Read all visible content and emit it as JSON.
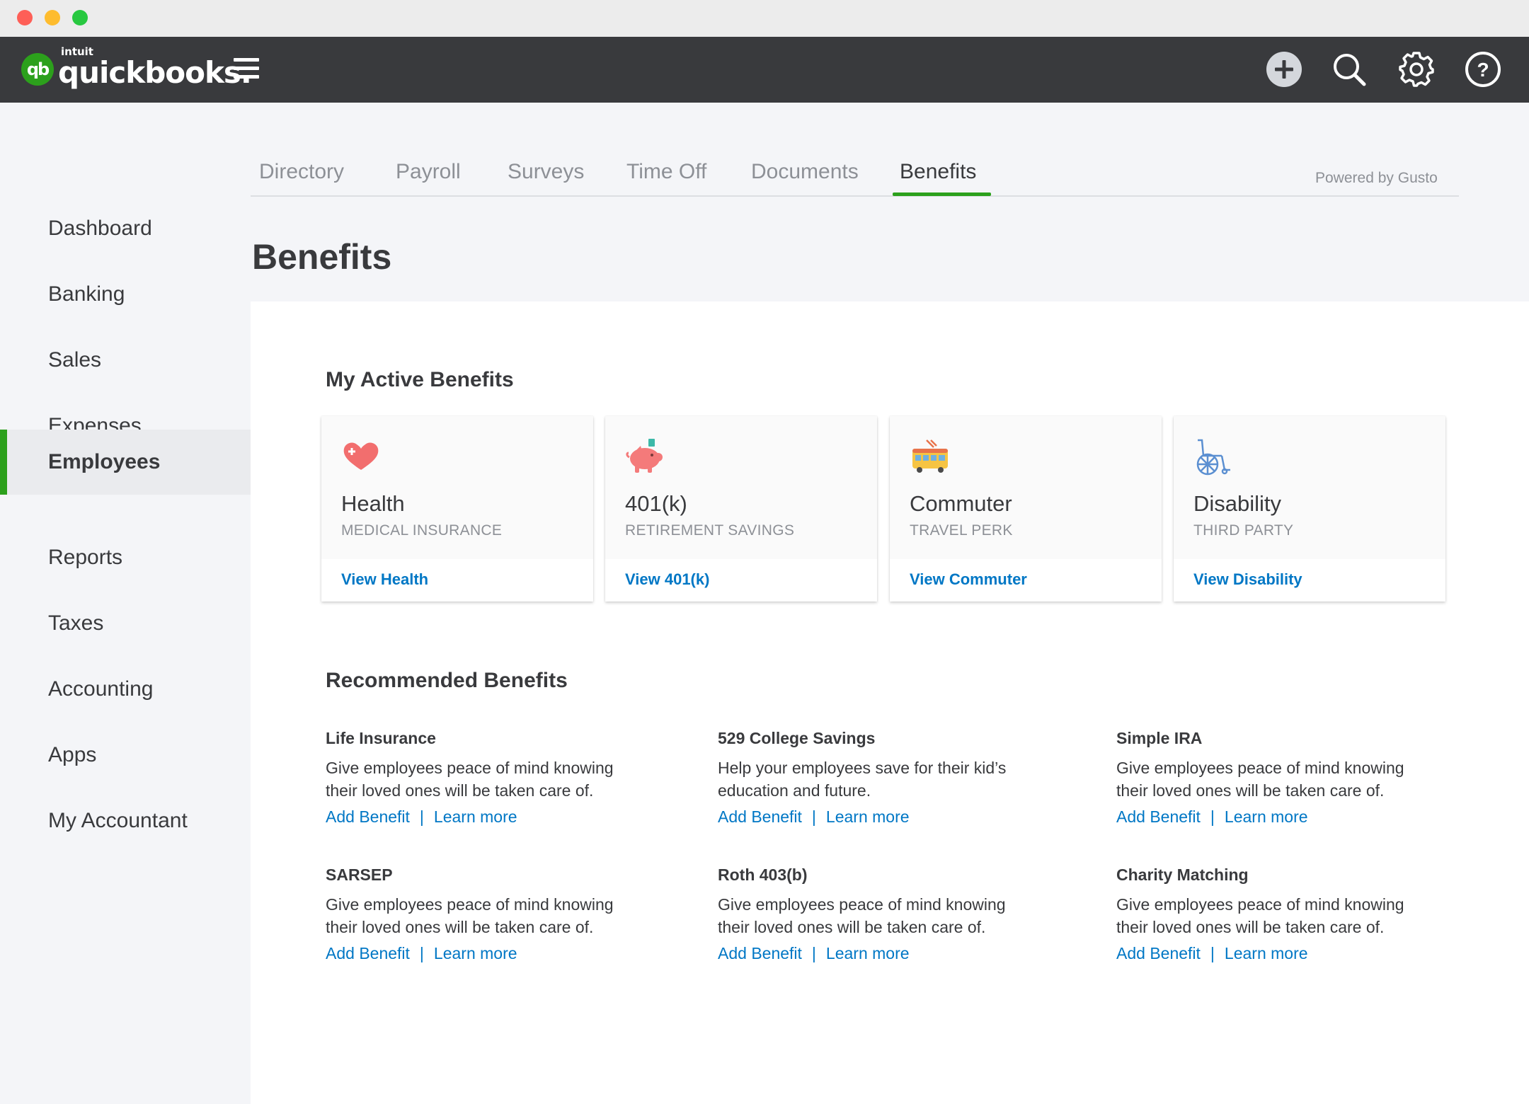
{
  "app": {
    "brand_small": "intuit",
    "brand_name": "quickbooks.",
    "logo_mark": "qb"
  },
  "topnav_icons": [
    "plus-icon",
    "search-icon",
    "gear-icon",
    "help-icon"
  ],
  "sidebar": {
    "items": [
      {
        "label": "Dashboard"
      },
      {
        "label": "Banking"
      },
      {
        "label": "Sales"
      },
      {
        "label": "Expenses"
      },
      {
        "label": "Employees",
        "active": true
      },
      {
        "label": "Reports"
      },
      {
        "label": "Taxes"
      },
      {
        "label": "Accounting"
      },
      {
        "label": "Apps"
      },
      {
        "label": "My Accountant"
      }
    ]
  },
  "tabs": [
    {
      "label": "Directory"
    },
    {
      "label": "Payroll"
    },
    {
      "label": "Surveys"
    },
    {
      "label": "Time Off"
    },
    {
      "label": "Documents"
    },
    {
      "label": "Benefits",
      "active": true
    }
  ],
  "powered_by": "Powered by Gusto",
  "page_title": "Benefits",
  "active_benefits": {
    "heading": "My Active Benefits",
    "cards": [
      {
        "icon": "heart-icon",
        "title": "Health",
        "subtitle": "MEDICAL INSURANCE",
        "link": "View Health"
      },
      {
        "icon": "piggy-bank-icon",
        "title": "401(k)",
        "subtitle": "RETIREMENT SAVINGS",
        "link": "View 401(k)"
      },
      {
        "icon": "trolley-icon",
        "title": "Commuter",
        "subtitle": "TRAVEL PERK",
        "link": "View Commuter"
      },
      {
        "icon": "wheelchair-icon",
        "title": "Disability",
        "subtitle": "THIRD PARTY",
        "link": "View Disability"
      }
    ]
  },
  "recommended": {
    "heading": "Recommended Benefits",
    "add_label": "Add Benefit",
    "learn_label": "Learn more",
    "separator": "|",
    "items": [
      {
        "title": "Life Insurance",
        "line1": "Give employees peace of mind knowing",
        "line2": "their loved ones will be taken care of."
      },
      {
        "title": "529 College Savings",
        "line1": "Help your employees save for their kid’s",
        "line2": "education and future."
      },
      {
        "title": "Simple IRA",
        "line1": "Give employees peace of mind knowing",
        "line2": "their loved ones will be taken care of."
      },
      {
        "title": "SARSEP",
        "line1": "Give employees peace of mind knowing",
        "line2": "their loved ones will be taken care of."
      },
      {
        "title": "Roth 403(b)",
        "line1": "Give employees peace of mind knowing",
        "line2": "their loved ones will be taken care of."
      },
      {
        "title": "Charity Matching",
        "line1": "Give employees peace of mind knowing",
        "line2": "their loved ones will be taken care of."
      }
    ]
  },
  "colors": {
    "brand_green": "#2ca01c",
    "link_blue": "#0077c5",
    "nav_dark": "#393a3d"
  }
}
